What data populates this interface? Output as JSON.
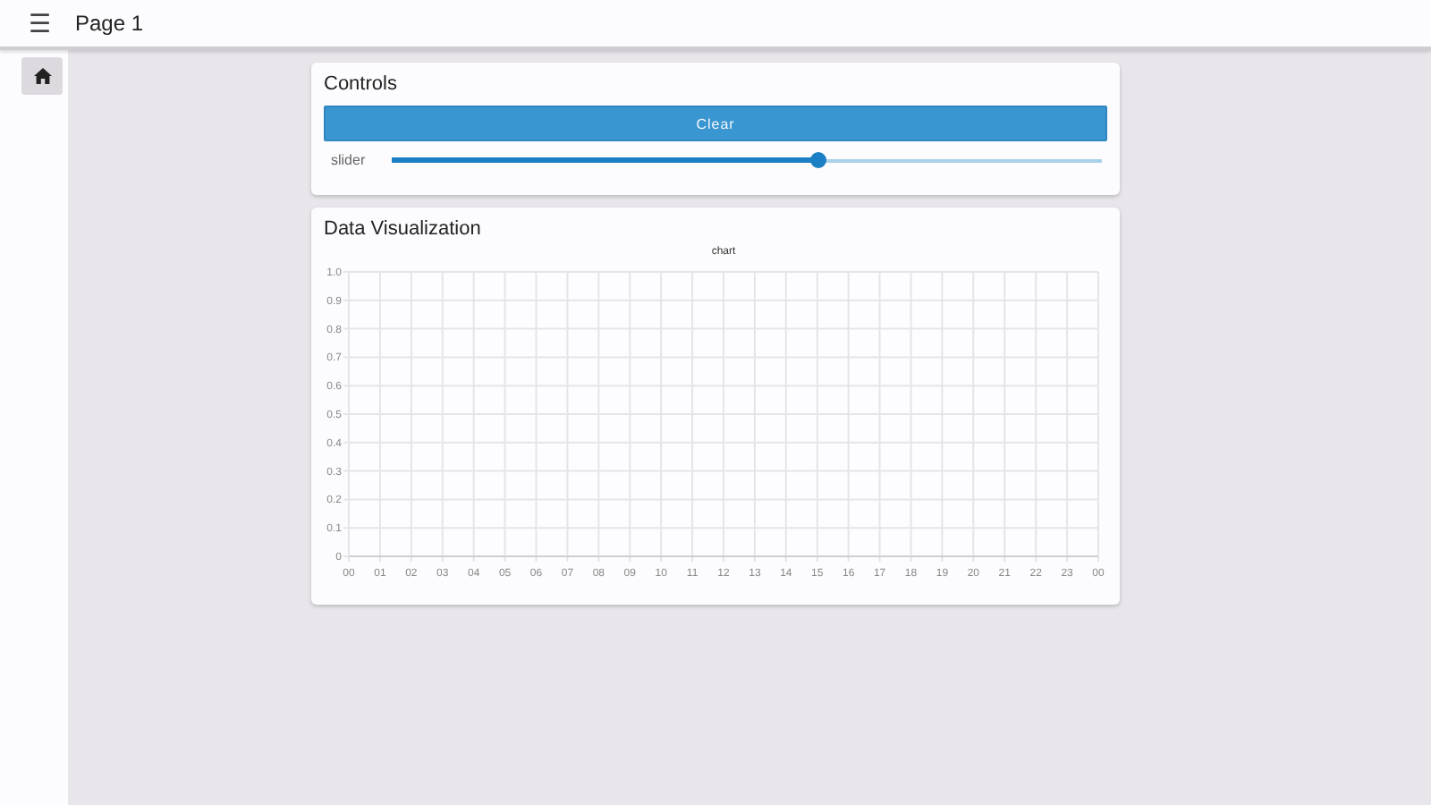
{
  "app_bar": {
    "menu_icon": "☰",
    "title": "Page 1"
  },
  "sidebar": {
    "items": [
      {
        "kind": "home",
        "selected": true
      }
    ]
  },
  "controls_card": {
    "title": "Controls",
    "button": "Clear",
    "slider": {
      "label": "slider",
      "level": 0.6
    }
  },
  "visualization_card": {
    "title": "Data Visualization",
    "chart_data": {
      "type": "line",
      "title": "chart",
      "grid": true,
      "xlim": [
        0,
        24
      ],
      "ylim": [
        0,
        1
      ],
      "xticks": [
        {
          "value": 0,
          "label": "00"
        },
        {
          "value": 1,
          "label": "01"
        },
        {
          "value": 2,
          "label": "02"
        },
        {
          "value": 3,
          "label": "03"
        },
        {
          "value": 4,
          "label": "04"
        },
        {
          "value": 5,
          "label": "05"
        },
        {
          "value": 6,
          "label": "06"
        },
        {
          "value": 7,
          "label": "07"
        },
        {
          "value": 8,
          "label": "08"
        },
        {
          "value": 9,
          "label": "09"
        },
        {
          "value": 10,
          "label": "10"
        },
        {
          "value": 11,
          "label": "11"
        },
        {
          "value": 12,
          "label": "12"
        },
        {
          "value": 13,
          "label": "13"
        },
        {
          "value": 14,
          "label": "14"
        },
        {
          "value": 15,
          "label": "15"
        },
        {
          "value": 16,
          "label": "16"
        },
        {
          "value": 17,
          "label": "17"
        },
        {
          "value": 18,
          "label": "18"
        },
        {
          "value": 19,
          "label": "19"
        },
        {
          "value": 20,
          "label": "20"
        },
        {
          "value": 21,
          "label": "21"
        },
        {
          "value": 22,
          "label": "22"
        },
        {
          "value": 23,
          "label": "23"
        },
        {
          "value": 24,
          "label": "00"
        }
      ],
      "yticks": [
        0,
        {
          "value": 0.1,
          "label": "0.1"
        },
        {
          "value": 0.2,
          "label": "0.2"
        },
        {
          "value": 0.3,
          "label": "0.3"
        },
        {
          "value": 0.4,
          "label": "0.4"
        },
        {
          "value": 0.5,
          "label": "0.5"
        },
        {
          "value": 0.6,
          "label": "0.6"
        },
        {
          "value": 0.7,
          "label": "0.7"
        },
        {
          "value": 0.8,
          "label": "0.8"
        },
        {
          "value": 0.9,
          "label": "0.9"
        },
        {
          "value": 1,
          "label": "1.0"
        }
      ]
    }
  }
}
